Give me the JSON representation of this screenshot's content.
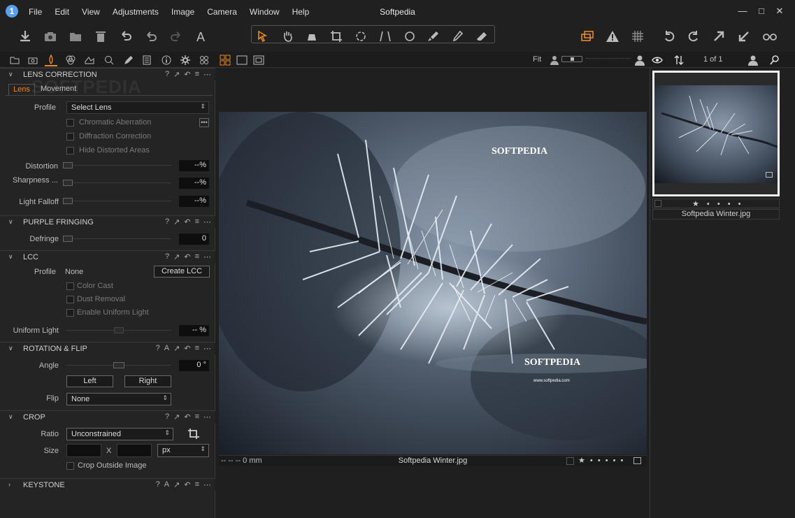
{
  "app": {
    "title": "Softpedia",
    "menu": [
      "File",
      "Edit",
      "View",
      "Adjustments",
      "Image",
      "Camera",
      "Window",
      "Help"
    ],
    "watermark": "SOFTPEDIA"
  },
  "toolbar": {
    "left_icons": [
      "import-icon",
      "camera-icon",
      "folder-icon",
      "trash-icon",
      "undo-all-icon",
      "undo-icon",
      "redo-icon",
      "text-icon"
    ],
    "cursor_tools": [
      "select-cursor-icon",
      "pan-icon",
      "loupe-icon",
      "crop-icon",
      "rotate-icon",
      "keystone-icon",
      "spot-icon",
      "brush-icon",
      "picker-icon",
      "eraser-icon"
    ],
    "right_icons": [
      "multi-view-icon",
      "warning-icon",
      "grid-icon",
      "rotate-left-icon",
      "rotate-right-icon",
      "export-icon",
      "import-arrow-icon",
      "glasses-icon"
    ]
  },
  "tabstrip": {
    "zoom_label": "Fit",
    "counter": "1 of 1"
  },
  "lens_correction": {
    "title": "LENS CORRECTION",
    "tab_lens": "Lens",
    "tab_movement": "Movement",
    "profile_label": "Profile",
    "profile_placeholder": "Select Lens",
    "chromatic": "Chromatic Aberration",
    "diffraction": "Diffraction Correction",
    "hide_distorted": "Hide Distorted Areas",
    "distortion_label": "Distortion",
    "distortion_val": "--%",
    "sharpness_label": "Sharpness ...",
    "sharpness_val": "--%",
    "falloff_label": "Light Falloff",
    "falloff_val": "--%",
    "more": "•••"
  },
  "purple_fringing": {
    "title": "PURPLE FRINGING",
    "defringe_label": "Defringe",
    "defringe_val": "0"
  },
  "lcc": {
    "title": "LCC",
    "profile_label": "Profile",
    "profile_val": "None",
    "create_btn": "Create LCC",
    "color_cast": "Color Cast",
    "dust_removal": "Dust Removal",
    "uniform_enable": "Enable Uniform Light",
    "uniform_label": "Uniform Light",
    "uniform_val": "-- %"
  },
  "rotation": {
    "title": "ROTATION & FLIP",
    "angle_label": "Angle",
    "angle_val": "0 °",
    "left_btn": "Left",
    "right_btn": "Right",
    "flip_label": "Flip",
    "flip_val": "None"
  },
  "crop": {
    "title": "CROP",
    "ratio_label": "Ratio",
    "ratio_val": "Unconstrained",
    "size_label": "Size",
    "size_x": "X",
    "unit": "px",
    "outside": "Crop Outside Image"
  },
  "keystone": {
    "title": "KEYSTONE"
  },
  "viewer": {
    "filename": "Softpedia Winter.jpg",
    "focal": "-- -- -- 0 mm",
    "photo_logo": "SOFTPEDIA",
    "photo_url": "www.softpedia.com",
    "rating_dots": "★ • • • • •"
  },
  "browser": {
    "thumb_name": "Softpedia Winter.jpg",
    "thumb_rating": "★ • • • •"
  },
  "colors": {
    "accent": "#e8892a",
    "bg": "#1e1e1e"
  }
}
